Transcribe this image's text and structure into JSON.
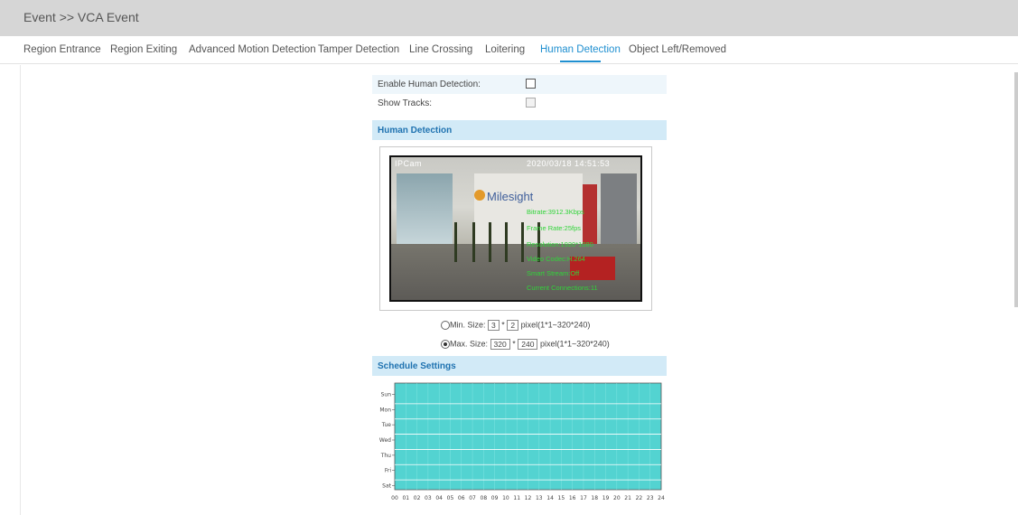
{
  "breadcrumb": "Event >> VCA Event",
  "tabs": [
    {
      "label": "Region Entrance"
    },
    {
      "label": "Region Exiting"
    },
    {
      "label": "Advanced Motion Detection"
    },
    {
      "label": "Tamper Detection"
    },
    {
      "label": "Line Crossing"
    },
    {
      "label": "Loitering"
    },
    {
      "label": "Human Detection",
      "active": true
    },
    {
      "label": "Object Left/Removed"
    }
  ],
  "colors": {
    "accent": "#1f8fd0",
    "header_bg": "#d6d6d6",
    "section_bg": "#d2eaf7",
    "schedule_fill": "#53d3d1"
  },
  "form": {
    "enable_label": "Enable Human Detection:",
    "enable_checked": false,
    "tracks_label": "Show Tracks:",
    "tracks_checked": false
  },
  "human_section_title": "Human Detection",
  "video": {
    "logo_text": "Milesight",
    "osd_top_left": "IPCam",
    "osd_top_right": "2020/03/18 14:51:53",
    "overlay": [
      "Bitrate:3912.3Kbps",
      "Frame Rate:25fps",
      "Resolution:1920*1080",
      "Video Codec:H.264",
      "Smart Stream:Off",
      "Current Connections:11"
    ]
  },
  "min_size": {
    "label": "Min. Size:",
    "w": "3",
    "sep": "*",
    "h": "2",
    "unit": "pixel(1*1~320*240)",
    "selected": false
  },
  "max_size": {
    "label": "Max. Size:",
    "w": "320",
    "sep": "*",
    "h": "240",
    "unit": "pixel(1*1~320*240)",
    "selected": true
  },
  "schedule_title": "Schedule Settings",
  "schedule": {
    "days": [
      "Sun",
      "Mon",
      "Tue",
      "Wed",
      "Thu",
      "Fri",
      "Sat"
    ],
    "hours": [
      "00",
      "01",
      "02",
      "03",
      "04",
      "05",
      "06",
      "07",
      "08",
      "09",
      "10",
      "11",
      "12",
      "13",
      "14",
      "15",
      "16",
      "17",
      "18",
      "19",
      "20",
      "21",
      "22",
      "23",
      "24"
    ],
    "all_day_enabled": true
  }
}
